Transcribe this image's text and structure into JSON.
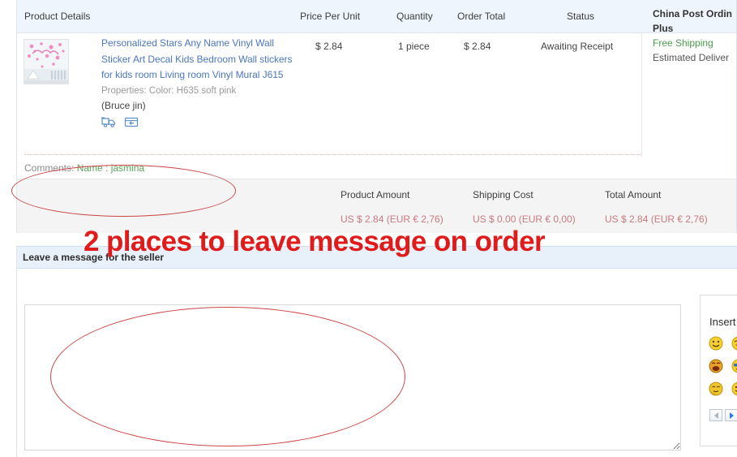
{
  "table": {
    "headers": {
      "product": "Product Details",
      "price_per_unit": "Price Per Unit",
      "quantity": "Quantity",
      "order_total": "Order Total",
      "status": "Status"
    },
    "row": {
      "product_title": "Personalized Stars Any Name Vinyl Wall Sticker Art Decal Kids Bedroom Wall stickers for kids room Living room Vinyl Mural J615",
      "properties": "Properties: Color: H635 soft pink",
      "seller": "(Bruce jin)",
      "price_per_unit": "$ 2.84",
      "quantity": "1 piece",
      "order_total": "$ 2.84",
      "status": "Awaiting Receipt",
      "shipping_method": "China Post Ordin",
      "shipping_method_line2": "Plus",
      "free_shipping": "Free Shipping",
      "estimated_delivery": "Estimated Deliver"
    },
    "comments": {
      "label": "Comments:",
      "value": "Name : jasmina"
    },
    "totals": {
      "product_amount_label": "Product Amount",
      "shipping_cost_label": "Shipping Cost",
      "total_amount_label": "Total Amount",
      "product_amount_value": "US $ 2.84 (EUR € 2,76)",
      "shipping_cost_value": "US $ 0.00 (EUR € 0,00)",
      "total_amount_value": "US $ 2.84 (EUR € 2,76)"
    }
  },
  "message_section": {
    "header": "Leave a message for the seller",
    "textarea_value": "",
    "textarea_placeholder": ""
  },
  "emoji_panel": {
    "title": "Insert",
    "emojis": [
      {
        "name": "smiley-grin-icon",
        "glyph": "☺"
      },
      {
        "name": "smiley-laugh-icon",
        "glyph": "☺"
      },
      {
        "name": "smiley-blush-icon",
        "glyph": "☺"
      },
      {
        "name": "smiley-tongue-icon",
        "glyph": "☺"
      },
      {
        "name": "smiley-cool-icon",
        "glyph": "☺"
      },
      {
        "name": "smiley-wink-icon",
        "glyph": "☺"
      },
      {
        "name": "smiley-shy-icon",
        "glyph": "☺"
      },
      {
        "name": "smiley-happy-icon",
        "glyph": "☺"
      },
      {
        "name": "smiley-sad-icon",
        "glyph": "☺"
      }
    ],
    "prev_label": "◄",
    "next_label": "►"
  },
  "annotations": {
    "headline": "2 places to leave message on order",
    "headline_color": "#e01b1b",
    "ellipse_color": "#cc4444"
  },
  "icons": {
    "shipping_truck": "shipping-truck-icon",
    "return_parcel": "return-parcel-icon"
  }
}
